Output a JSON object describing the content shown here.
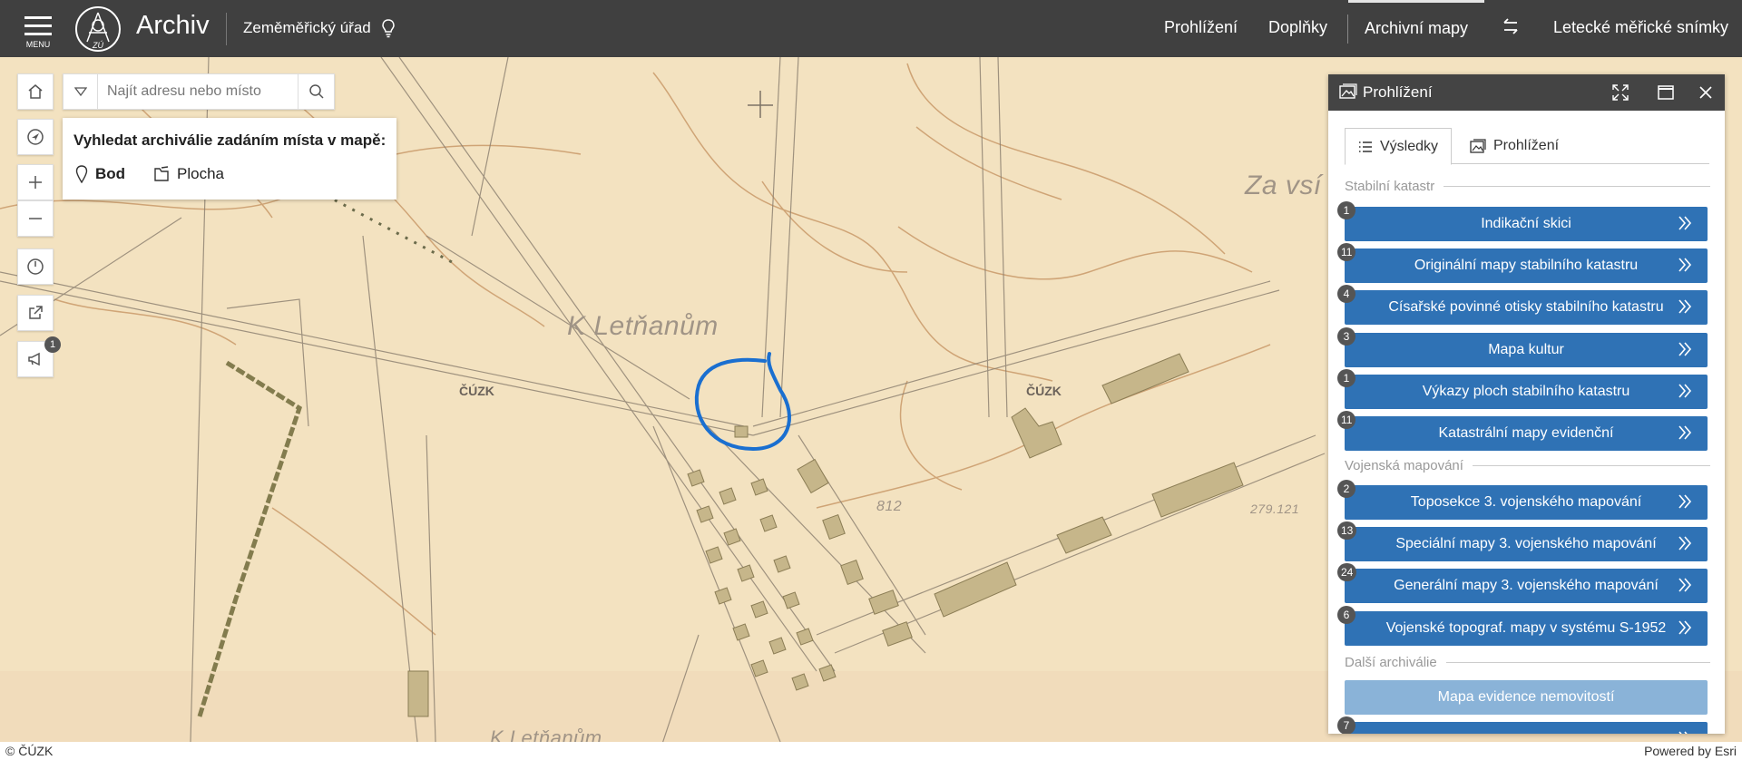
{
  "header": {
    "menu_label": "MENU",
    "logo_text": "ZÚ",
    "title": "Archiv",
    "subtitle": "Zeměměřický úřad",
    "nav": [
      {
        "label": "Prohlížení"
      },
      {
        "label": "Doplňky"
      },
      {
        "label": "Archivní mapy"
      },
      {
        "label": "Letecké měřické snímky"
      }
    ]
  },
  "search": {
    "placeholder": "Najít adresu nebo místo"
  },
  "tools": {
    "notification_count": "1"
  },
  "selection": {
    "title": "Vyhledat archiválie zadáním místa v mapě:",
    "point_label": "Bod",
    "area_label": "Plocha"
  },
  "map": {
    "labels": {
      "k_letnanum": "K Letňanům",
      "za_vsi": "Za vsí",
      "k_letnanum_bottom": "K Letňanům",
      "height_a": "812",
      "height_b": "279.121"
    },
    "watermark": "ČÚZK"
  },
  "panel": {
    "title": "Prohlížení",
    "tabs": [
      {
        "label": "Výsledky"
      },
      {
        "label": "Prohlížení"
      }
    ],
    "sections": [
      {
        "title": "Stabilní katastr",
        "items": [
          {
            "count": "1",
            "label": "Indikační skici"
          },
          {
            "count": "11",
            "label": "Originální mapy stabilního katastru"
          },
          {
            "count": "4",
            "label": "Císařské povinné otisky stabilního katastru"
          },
          {
            "count": "3",
            "label": "Mapa kultur"
          },
          {
            "count": "1",
            "label": "Výkazy ploch stabilního katastru"
          },
          {
            "count": "11",
            "label": "Katastrální mapy evidenční"
          }
        ]
      },
      {
        "title": "Vojenská mapování",
        "items": [
          {
            "count": "2",
            "label": "Toposekce 3. vojenského mapování"
          },
          {
            "count": "13",
            "label": "Speciální mapy 3. vojenského mapování"
          },
          {
            "count": "24",
            "label": "Generální mapy 3. vojenského mapování"
          },
          {
            "count": "6",
            "label": "Vojenské topograf. mapy v systému S-1952"
          }
        ]
      },
      {
        "title": "Další archiválie",
        "items": [
          {
            "label": "Mapa evidence nemovitostí"
          },
          {
            "count": "7",
            "label": ""
          }
        ]
      }
    ]
  },
  "footer": {
    "copyright": "© ČÚZK",
    "powered": "Powered by Esri"
  },
  "colors": {
    "header_bg": "#404040",
    "map_bg": "#f3e2c0",
    "button_blue": "#2f72b5",
    "button_disabled": "#8ab3d8",
    "highlight_circle": "#1a6fd0"
  }
}
